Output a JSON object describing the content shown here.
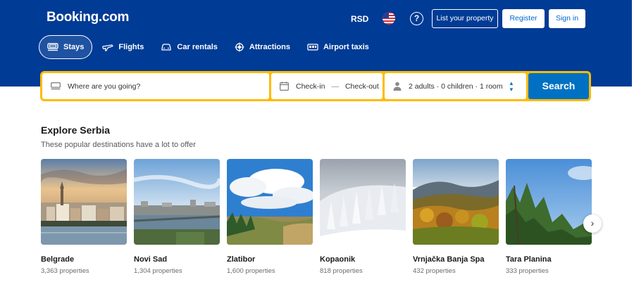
{
  "header": {
    "logo": "Booking.com",
    "currency": "RSD",
    "help": "?",
    "list_property": "List your property",
    "register": "Register",
    "sign_in": "Sign in"
  },
  "nav": [
    {
      "label": "Stays",
      "icon": "bed-icon",
      "active": true
    },
    {
      "label": "Flights",
      "icon": "plane-icon",
      "active": false
    },
    {
      "label": "Car rentals",
      "icon": "car-icon",
      "active": false
    },
    {
      "label": "Attractions",
      "icon": "attractions-icon",
      "active": false
    },
    {
      "label": "Airport taxis",
      "icon": "taxi-icon",
      "active": false
    }
  ],
  "search": {
    "destination_placeholder": "Where are you going?",
    "check_in": "Check-in",
    "date_separator": "—",
    "check_out": "Check-out",
    "occupancy": "2 adults · 0 children · 1 room",
    "button": "Search"
  },
  "explore": {
    "title": "Explore Serbia",
    "subtitle": "These popular destinations have a lot to offer",
    "destinations": [
      {
        "name": "Belgrade",
        "count": "3,363 properties"
      },
      {
        "name": "Novi Sad",
        "count": "1,304 properties"
      },
      {
        "name": "Zlatibor",
        "count": "1,600 properties"
      },
      {
        "name": "Kopaonik",
        "count": "818 properties"
      },
      {
        "name": "Vrnjačka Banja Spa",
        "count": "432 properties"
      },
      {
        "name": "Tara Planina",
        "count": "333 properties"
      }
    ]
  },
  "colors": {
    "brand_blue": "#003b95",
    "search_yellow": "#febb02",
    "action_blue": "#0071c2"
  }
}
